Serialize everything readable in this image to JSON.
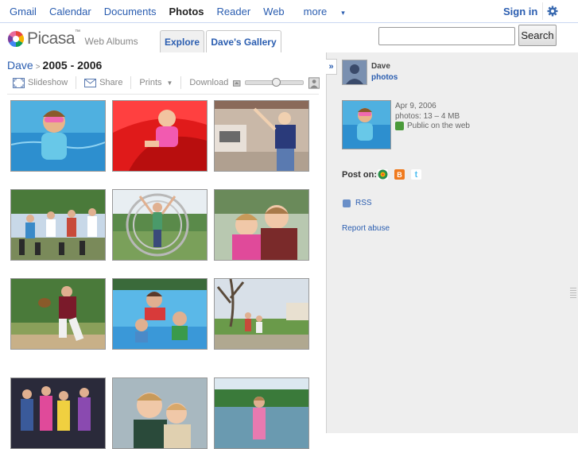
{
  "topnav": {
    "items": [
      {
        "label": "Gmail"
      },
      {
        "label": "Calendar"
      },
      {
        "label": "Documents"
      },
      {
        "label": "Photos",
        "active": true
      },
      {
        "label": "Reader"
      },
      {
        "label": "Web"
      },
      {
        "label": "more"
      }
    ],
    "signin": "Sign in",
    "settings_icon": "gear-icon"
  },
  "header": {
    "logo_word": "Picasa",
    "logo_tm": "™",
    "logo_sub": "Web Albums",
    "tabs": [
      {
        "label": "Explore"
      },
      {
        "label": "Dave's Gallery",
        "active": true
      }
    ],
    "search": {
      "value": "",
      "placeholder": "",
      "button": "Search"
    }
  },
  "album": {
    "breadcrumb_owner": "Dave",
    "breadcrumb_sep": ">",
    "title": "2005 - 2006",
    "toolbar": {
      "slideshow": "Slideshow",
      "share": "Share",
      "prints": "Prints",
      "download": "Download"
    },
    "zoom_level": 0.45,
    "photos": [
      {
        "id": 1,
        "scene": "kid-in-pool"
      },
      {
        "id": 2,
        "scene": "red-slide"
      },
      {
        "id": 3,
        "scene": "kid-outdoor-house"
      },
      {
        "id": 4,
        "scene": "group-giant-chess"
      },
      {
        "id": 5,
        "scene": "hoop-gyroscope"
      },
      {
        "id": 6,
        "scene": "two-kids-hug"
      },
      {
        "id": 7,
        "scene": "baseball-pitcher"
      },
      {
        "id": 8,
        "scene": "family-in-pool"
      },
      {
        "id": 9,
        "scene": "yard-kids"
      },
      {
        "id": 10,
        "scene": "group-night"
      },
      {
        "id": 11,
        "scene": "two-kids-portrait"
      },
      {
        "id": 12,
        "scene": "girl-at-river"
      }
    ]
  },
  "sidebar": {
    "collapse_glyph": "»",
    "owner": {
      "name": "Dave",
      "link": "photos"
    },
    "date": "Apr 9, 2006",
    "photos_count": "photos: 13 – 4 MB",
    "visibility": "Public on the web",
    "post_on_label": "Post on:",
    "share_targets": [
      {
        "icon": "buzz-icon",
        "color": "#2a8f4a"
      },
      {
        "icon": "blogger-icon",
        "color": "#f07a1e"
      },
      {
        "icon": "twitter-icon",
        "color": "#4fbef0"
      }
    ],
    "rss": "RSS",
    "report": "Report abuse"
  }
}
